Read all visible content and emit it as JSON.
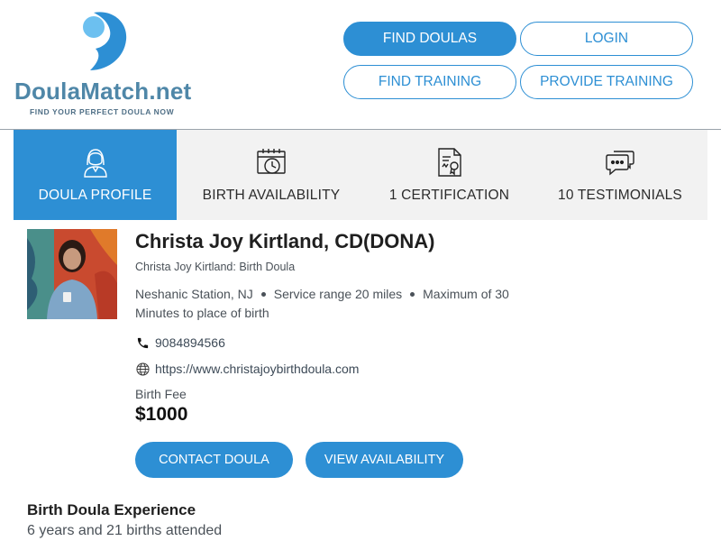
{
  "brand": {
    "logo_name_part1": "Doula",
    "logo_name_part2": "Match",
    "logo_name_part3": ".net",
    "tagline": "FIND YOUR PERFECT DOULA NOW",
    "accent_color": "#2d8fd4"
  },
  "nav": {
    "find_doulas": "FIND DOULAS",
    "login": "LOGIN",
    "find_training": "FIND TRAINING",
    "provide_training": "PROVIDE TRAINING"
  },
  "tabs": [
    {
      "label": "DOULA PROFILE",
      "icon": "doula-icon",
      "active": true
    },
    {
      "label": "BIRTH AVAILABILITY",
      "icon": "calendar-clock-icon",
      "active": false
    },
    {
      "label": "1 CERTIFICATION",
      "icon": "certificate-icon",
      "active": false
    },
    {
      "label": "10 TESTIMONIALS",
      "icon": "chat-bubbles-icon",
      "active": false
    }
  ],
  "profile": {
    "name": "Christa Joy Kirtland, CD(DONA)",
    "subtitle": "Christa Joy Kirtland: Birth Doula",
    "location": "Neshanic Station, NJ",
    "service_range": "Service range 20 miles",
    "maximum": "Maximum of 30",
    "maximum_cont": "Minutes to place of birth",
    "phone": "9084894566",
    "website": "https://www.christajoybirthdoula.com",
    "fee_label": "Birth Fee",
    "fee_value": "$1000",
    "contact_button": "CONTACT DOULA",
    "availability_button": "VIEW AVAILABILITY"
  },
  "experience": {
    "title": "Birth Doula Experience",
    "text": "6 years and 21 births attended"
  }
}
